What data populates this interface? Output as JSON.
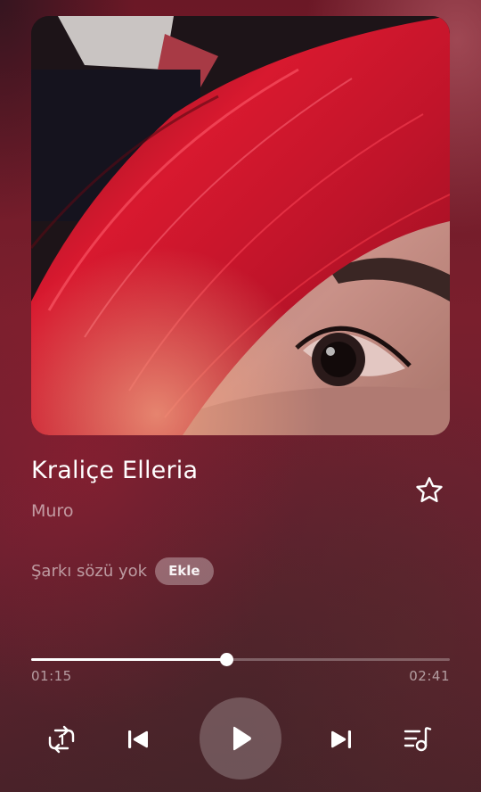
{
  "track": {
    "title": "Kraliçe Elleria",
    "artist": "Muro"
  },
  "lyrics": {
    "status_text": "Şarkı sözü yok",
    "add_label": "Ekle"
  },
  "playback": {
    "current_time": "01:15",
    "total_time": "02:41",
    "progress_fraction": 0.466,
    "is_playing": false,
    "is_favorite": false,
    "repeat_mode": "repeat-one"
  },
  "icons": {
    "favorite": "star-outline-icon",
    "repeat": "repeat-one-icon",
    "previous": "skip-previous-icon",
    "play": "play-icon",
    "next": "skip-next-icon",
    "queue": "playlist-music-icon"
  },
  "colors": {
    "background": "#6b1826",
    "accent": "#ffffff",
    "hair": "#d01a2e"
  }
}
